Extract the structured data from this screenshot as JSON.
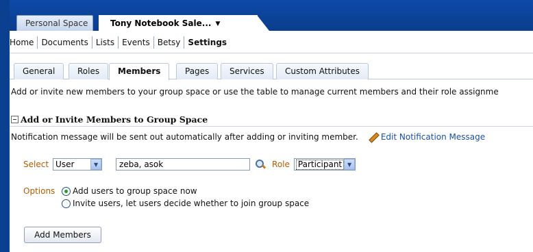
{
  "space_tabs": {
    "personal": "Personal Space",
    "active": "Tony Notebook Sale..."
  },
  "nav": {
    "items": [
      "Home",
      "Documents",
      "Lists",
      "Events",
      "Betsy",
      "Settings"
    ]
  },
  "settings_tabs": [
    "General",
    "Roles",
    "Members",
    "Pages",
    "Services",
    "Custom Attributes"
  ],
  "intro_text": "Add or invite new members to your group space or use the table to manage current members and their role assignme",
  "section": {
    "title": "Add or Invite Members to Group Space",
    "notification_text": "Notification message will be sent out automatically after adding or inviting member.",
    "edit_link": "Edit Notification Message"
  },
  "form": {
    "select_label": "Select",
    "select_value": "User",
    "users_value": "zeba, asok",
    "role_label": "Role",
    "role_value": "Participant",
    "options_label": "Options",
    "option_add": "Add users to group space now",
    "option_invite": "Invite users, let users decide whether to join group space",
    "add_button": "Add Members"
  },
  "colors": {
    "banner": "#0b3f8f",
    "label_orange": "#b45a00",
    "link_blue": "#1a4fa3"
  }
}
